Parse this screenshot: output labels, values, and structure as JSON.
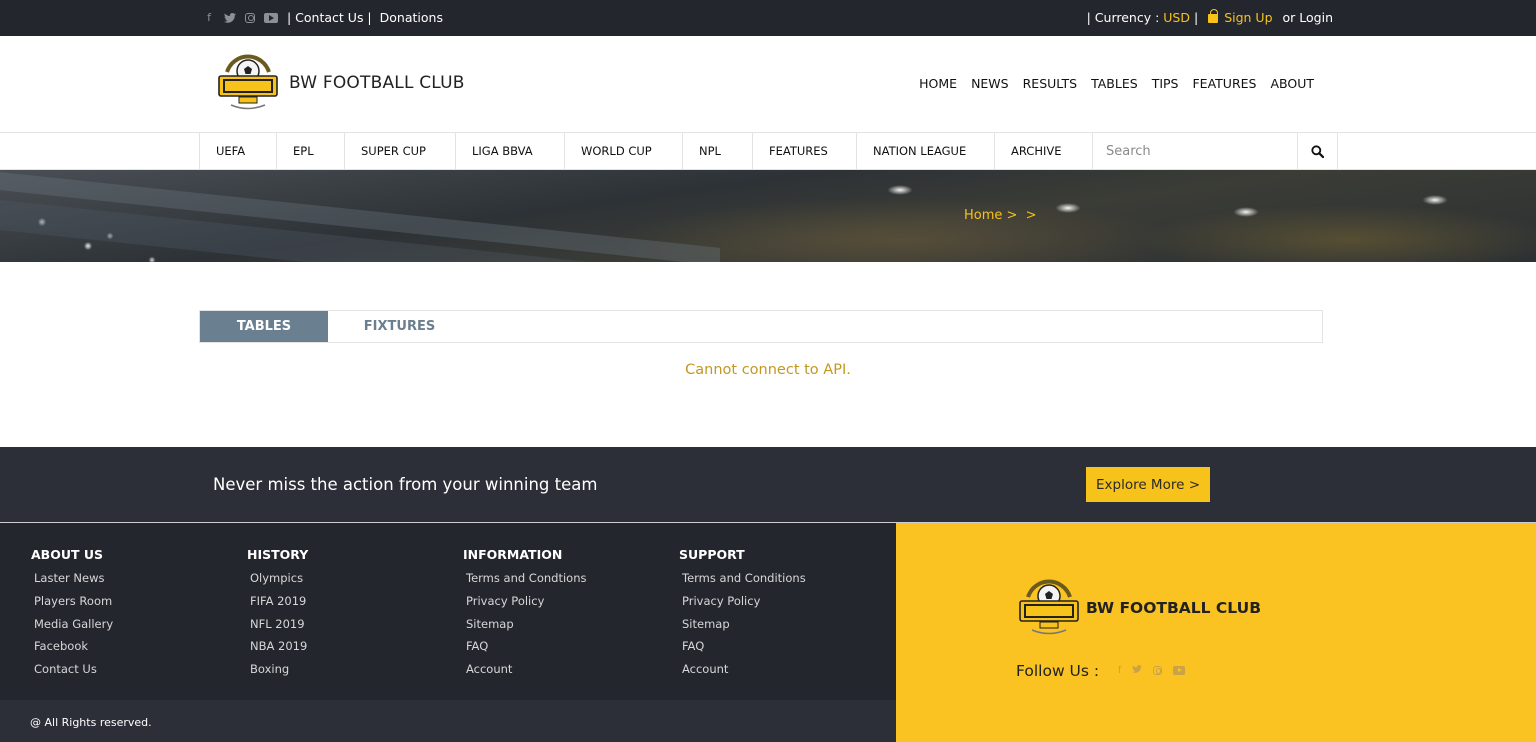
{
  "topbar": {
    "social_icons": [
      "facebook-icon",
      "twitter-icon",
      "instagram-icon",
      "youtube-icon"
    ],
    "contact": "| Contact Us |",
    "donations": "Donations",
    "currency_label": "| Currency : ",
    "currency_value": "USD",
    "currency_end": " |",
    "signup": "Sign Up",
    "login": "or Login"
  },
  "header": {
    "logo_icon": "football-club-logo",
    "brand": "BW FOOTBALL CLUB",
    "nav": [
      "HOME",
      "NEWS",
      "RESULTS",
      "TABLES",
      "TIPS",
      "FEATURES",
      "ABOUT"
    ]
  },
  "categories": {
    "items": [
      "UEFA",
      "EPL",
      "SUPER CUP",
      "LIGA BBVA",
      "WORLD CUP",
      "NPL",
      "FEATURES",
      "NATION LEAGUE",
      "ARCHIVE"
    ],
    "search_placeholder": "Search"
  },
  "banner": {
    "breadcrumb": "Home >  >"
  },
  "content": {
    "tabs": [
      "TABLES",
      "FIXTURES"
    ],
    "active_tab": "TABLES",
    "message": "Cannot connect to API."
  },
  "cta": {
    "message": "Never miss the action from your winning team",
    "button": "Explore More >"
  },
  "footer": {
    "columns": [
      {
        "title": "ABOUT US",
        "links": [
          "Laster News",
          "Players Room",
          "Media Gallery",
          "Facebook",
          "Contact Us"
        ]
      },
      {
        "title": "HISTORY",
        "links": [
          "Olympics",
          "FIFA 2019",
          "NFL 2019",
          "NBA 2019",
          "Boxing"
        ]
      },
      {
        "title": "INFORMATION",
        "links": [
          "Terms and Condtions",
          "Privacy Policy",
          "Sitemap",
          "FAQ",
          "Account"
        ]
      },
      {
        "title": "SUPPORT",
        "links": [
          "Terms and Conditions",
          "Privacy Policy",
          "Sitemap",
          "FAQ",
          "Account"
        ]
      }
    ],
    "copyright": "@ All Rights reserved.",
    "brand": "BW FOOTBALL CLUB",
    "follow": "Follow Us :"
  },
  "colors": {
    "accent": "#f7c21a",
    "dark": "#24262e",
    "tab_active": "#6a7f8f",
    "message": "#c29822"
  }
}
